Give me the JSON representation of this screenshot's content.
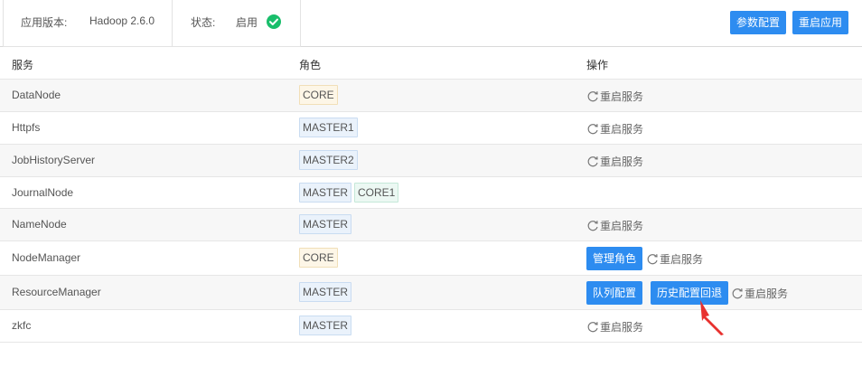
{
  "app_info": {
    "version_label": "应用版本:",
    "version_value": "Hadoop 2.6.0",
    "status_label": "状态:",
    "status_value": "启用",
    "status_color": "#19be6b"
  },
  "toolbar": {
    "param_config_label": "参数配置",
    "restart_app_label": "重启应用",
    "accent_color": "#2d8cf0"
  },
  "table": {
    "headers": {
      "service": "服务",
      "role": "角色",
      "action": "操作"
    },
    "restart_label": "重启服务",
    "rows": [
      {
        "service": "DataNode",
        "roles": [
          "CORE"
        ]
      },
      {
        "service": "Httpfs",
        "roles": [
          "MASTER1"
        ]
      },
      {
        "service": "JobHistoryServer",
        "roles": [
          "MASTER2"
        ]
      },
      {
        "service": "JournalNode",
        "roles": [
          "MASTER",
          "CORE1"
        ]
      },
      {
        "service": "NameNode",
        "roles": [
          "MASTER"
        ]
      },
      {
        "service": "NodeManager",
        "roles": [
          "CORE"
        ],
        "manage_roles_label": "管理角色"
      },
      {
        "service": "ResourceManager",
        "roles": [
          "MASTER"
        ],
        "queue_config_label": "队列配置",
        "history_rollback_label": "历史配置回退"
      },
      {
        "service": "zkfc",
        "roles": [
          "MASTER"
        ]
      }
    ]
  },
  "annotation": {
    "arrow_color": "#e8312f",
    "icon": "red-arrow-pointer"
  }
}
